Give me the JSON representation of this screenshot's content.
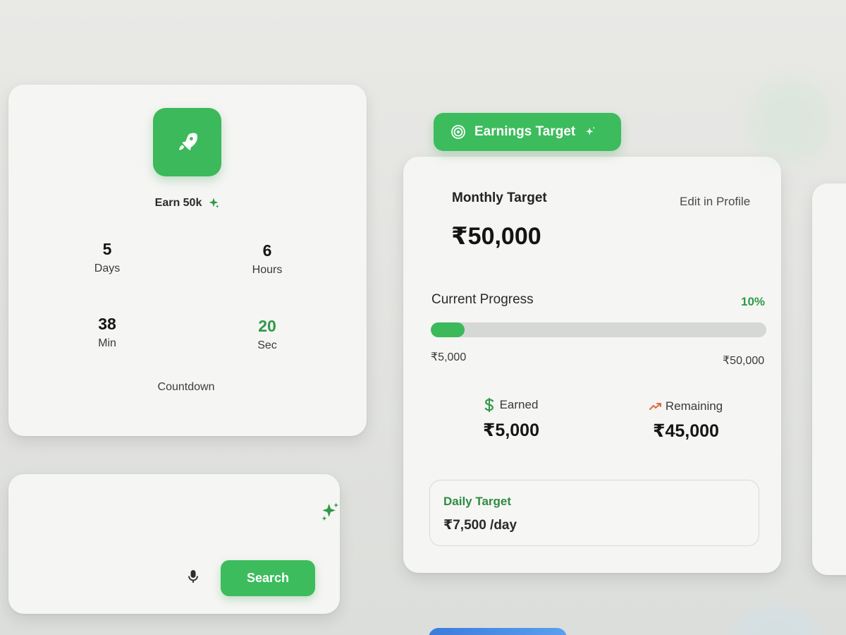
{
  "countdown": {
    "goal_label": "Earn 50k",
    "units": [
      {
        "value": "5",
        "label": "Days"
      },
      {
        "value": "6",
        "label": "Hours"
      },
      {
        "value": "38",
        "label": "Min"
      },
      {
        "value": "20",
        "label": "Sec"
      }
    ],
    "caption": "Countdown"
  },
  "search": {
    "button_label": "Search"
  },
  "earnings": {
    "badge_label": "Earnings Target",
    "monthly_label": "Monthly Target",
    "edit_link": "Edit in Profile",
    "monthly_amount": "₹50,000",
    "progress_label": "Current Progress",
    "progress_percent_text": "10%",
    "progress_fraction": 0.1,
    "range_min": "₹5,000",
    "range_max": "₹50,000",
    "earned_label": "Earned",
    "earned_value": "₹5,000",
    "remaining_label": "Remaining",
    "remaining_value": "₹45,000",
    "daily_label": "Daily Target",
    "daily_value": "₹7,500 /day"
  },
  "icons": {
    "rocket": "rocket-icon",
    "sparkles": "sparkles-icon",
    "target": "target-icon",
    "mic": "microphone-icon",
    "dollar": "dollar-icon",
    "trend": "trending-up-icon"
  },
  "colors": {
    "accent_green": "#3cbc5c",
    "text_green": "#2f9a48",
    "trend_orange": "#e0693a"
  }
}
